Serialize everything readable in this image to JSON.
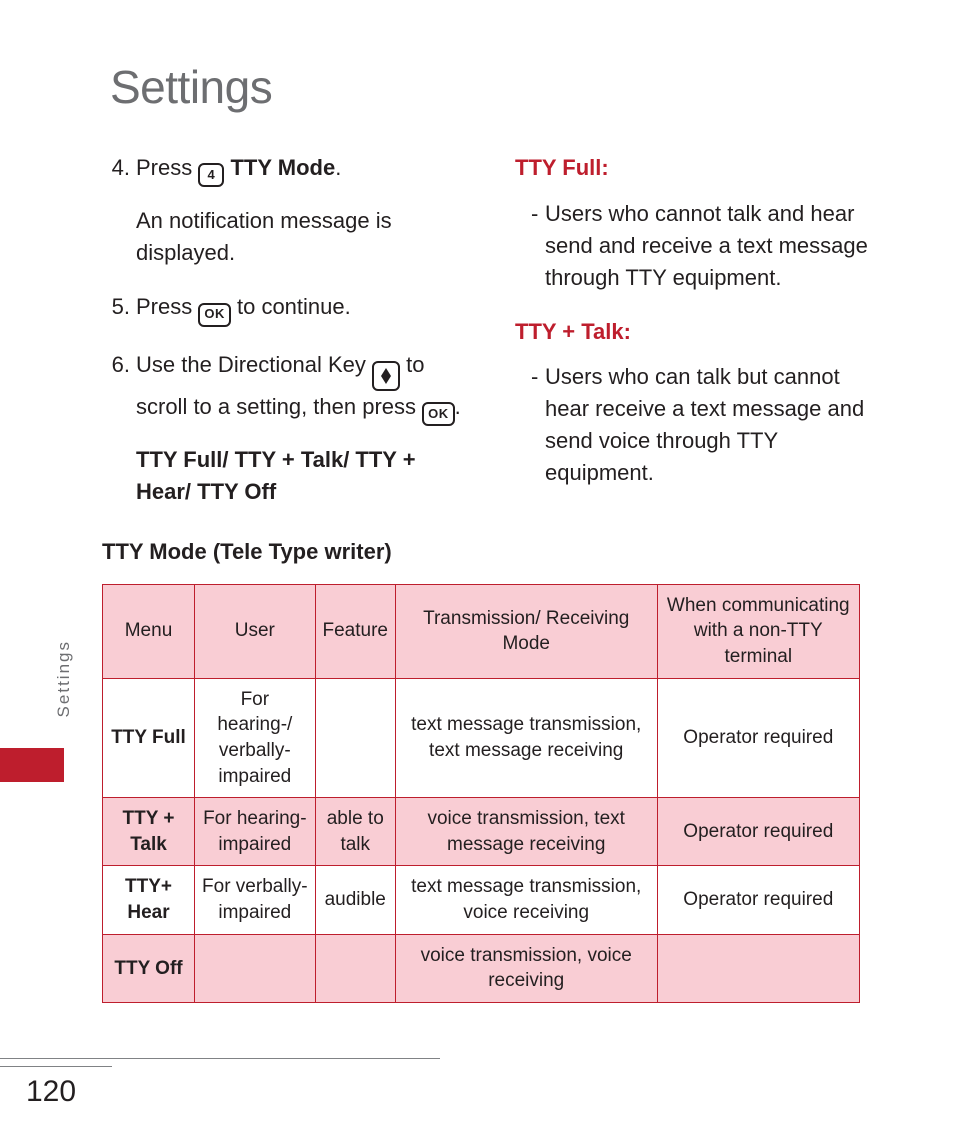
{
  "title": "Settings",
  "sideTab": "Settings",
  "pageNumber": "120",
  "left": {
    "step4": {
      "num": "4.",
      "pre": "Press ",
      "keyLabel": "4",
      "postStrong": " TTY Mode",
      "postPlain": ".",
      "sub": "An notification message is displayed."
    },
    "step5": {
      "num": "5.",
      "pre": "Press ",
      "keyLabel": "OK",
      "post": " to continue."
    },
    "step6": {
      "num": "6.",
      "pre": "Use the Directional Key ",
      "mid": " to scroll to a setting, then press ",
      "keyLabel": "OK",
      "post": ".",
      "subStrong": "TTY Full/ TTY + Talk/ TTY + Hear/ TTY Off"
    },
    "tableTitle": "TTY Mode (Tele Type writer)"
  },
  "right": {
    "full": {
      "head": "TTY Full:",
      "body": "Users who cannot  talk and hear send and receive a text message through TTY equipment."
    },
    "talk": {
      "head": "TTY + Talk:",
      "body": "Users who can talk but cannot hear receive a text message and send voice through TTY equipment."
    }
  },
  "table": {
    "headers": [
      "Menu",
      "User",
      "Feature",
      "Transmission/\nReceiving Mode",
      "When communicating with a non-TTY terminal"
    ],
    "rows": [
      {
        "menu": "TTY Full",
        "user": "For hearing-/ verbally-impaired",
        "feature": "",
        "mode": "text message transmission, text message receiving",
        "nontty": "Operator required",
        "alt": false
      },
      {
        "menu": "TTY + Talk",
        "user": "For hearing-impaired",
        "feature": "able to talk",
        "mode": "voice transmission, text message receiving",
        "nontty": "Operator required",
        "alt": true
      },
      {
        "menu": "TTY+ Hear",
        "user": "For verbally-impaired",
        "feature": "audible",
        "mode": "text message transmission, voice receiving",
        "nontty": "Operator required",
        "alt": false
      },
      {
        "menu": "TTY Off",
        "user": "",
        "feature": "",
        "mode": "voice transmission, voice receiving",
        "nontty": "",
        "alt": true
      }
    ]
  }
}
